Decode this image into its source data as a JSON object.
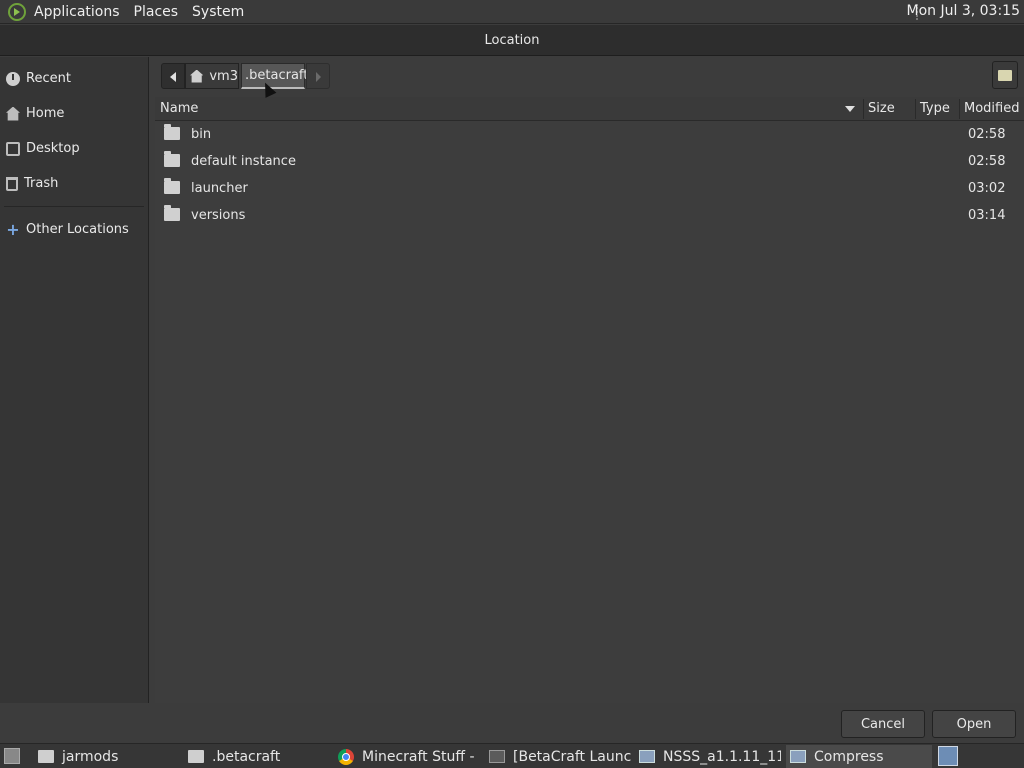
{
  "top_panel": {
    "menus": [
      "Applications",
      "Places",
      "System"
    ],
    "clock": "Mon Jul  3, 03:15"
  },
  "dialog": {
    "title": "Location"
  },
  "sidebar": {
    "items": [
      {
        "label": "Recent",
        "icon": "clock-icon"
      },
      {
        "label": "Home",
        "icon": "home-icon"
      },
      {
        "label": "Desktop",
        "icon": "desktop-icon"
      },
      {
        "label": "Trash",
        "icon": "trash-icon"
      }
    ],
    "other": {
      "label": "Other Locations",
      "icon": "plus-icon"
    }
  },
  "pathbar": {
    "crumbs": [
      "vm3",
      ".betacraft"
    ],
    "current": ".betacraft"
  },
  "columns": [
    "Name",
    "Size",
    "Type",
    "Modified"
  ],
  "files": [
    {
      "name": "bin",
      "size": "",
      "type": "",
      "modified": "02:58"
    },
    {
      "name": "default instance",
      "size": "",
      "type": "",
      "modified": "02:58"
    },
    {
      "name": "launcher",
      "size": "",
      "type": "",
      "modified": "03:02"
    },
    {
      "name": "versions",
      "size": "",
      "type": "",
      "modified": "03:14"
    }
  ],
  "buttons": {
    "cancel": "Cancel",
    "open": "Open"
  },
  "taskbar": {
    "tasks": [
      {
        "label": "jarmods",
        "icon": "folder-icon"
      },
      {
        "label": ".betacraft",
        "icon": "folder-icon"
      },
      {
        "label": "Minecraft Stuff - …",
        "icon": "chrome-icon"
      },
      {
        "label": "[BetaCraft Launc…",
        "icon": "terminal-icon"
      },
      {
        "label": "NSSS_a1.1.11_111…",
        "icon": "package-icon"
      },
      {
        "label": "Compress",
        "icon": "package-icon"
      }
    ]
  }
}
